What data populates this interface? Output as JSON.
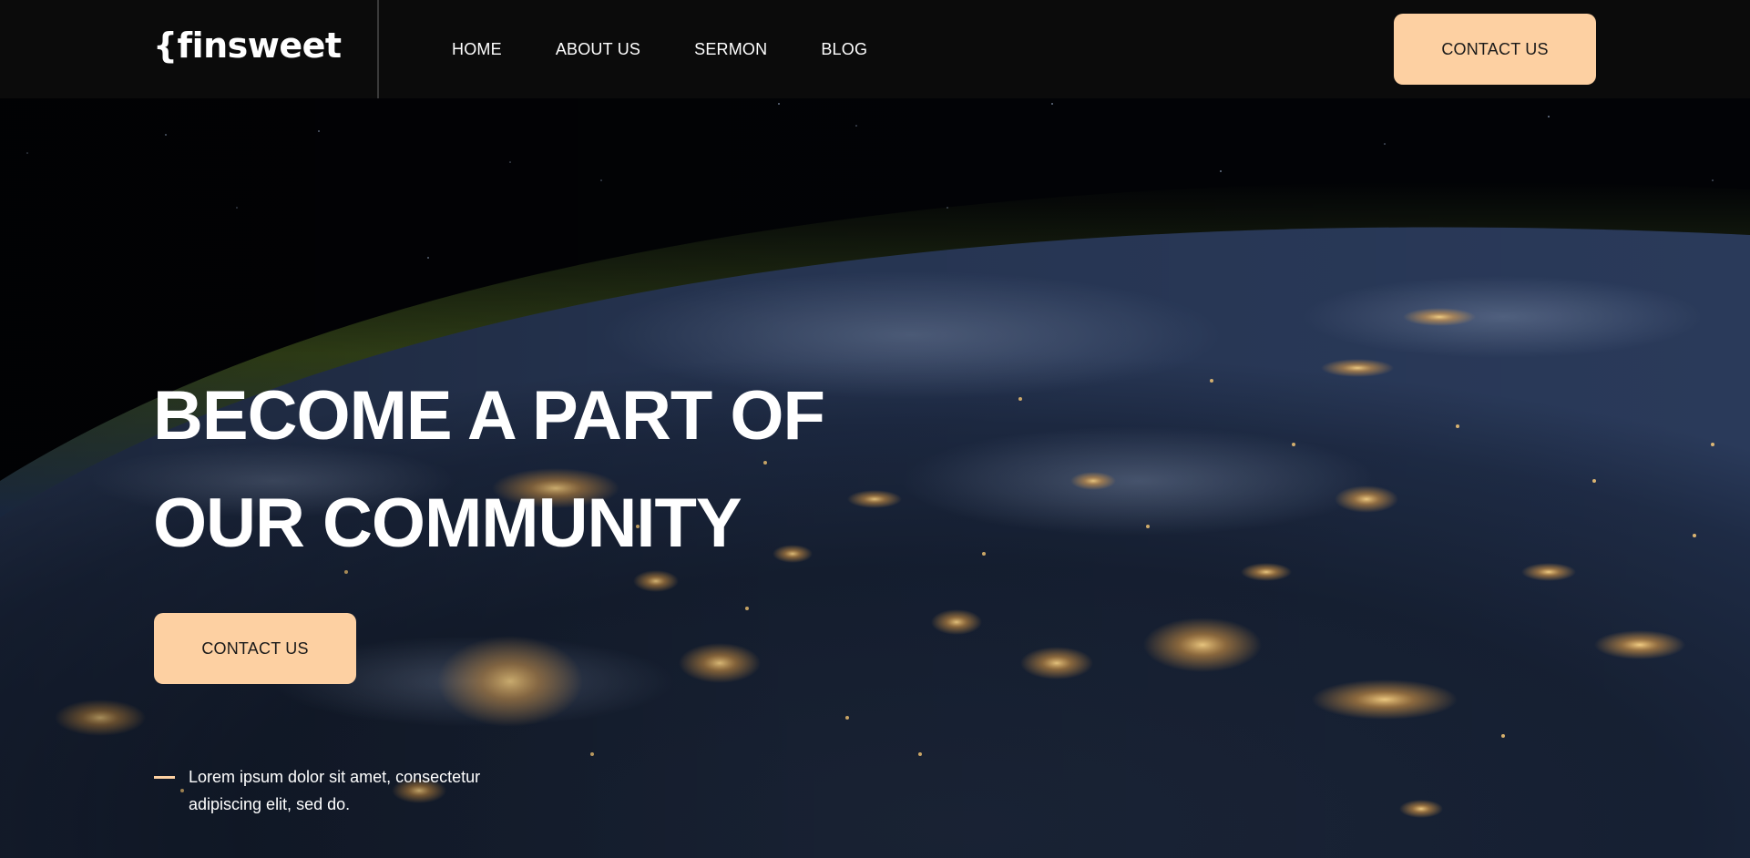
{
  "header": {
    "logo": "{finsweet",
    "nav": [
      {
        "label": "HOME"
      },
      {
        "label": "ABOUT US"
      },
      {
        "label": "SERMON"
      },
      {
        "label": "BLOG"
      }
    ],
    "cta_label": "CONTACT US"
  },
  "hero": {
    "headline_line1": "BECOME A PART OF",
    "headline_line2": "OUR COMMUNITY",
    "cta_label": "CONTACT US",
    "tagline": "Lorem ipsum dolor sit amet, consectetur adipiscing elit, sed do."
  },
  "colors": {
    "accent": "#fdd0a2",
    "header_bg": "#0b0b0b",
    "text": "#ffffff"
  }
}
